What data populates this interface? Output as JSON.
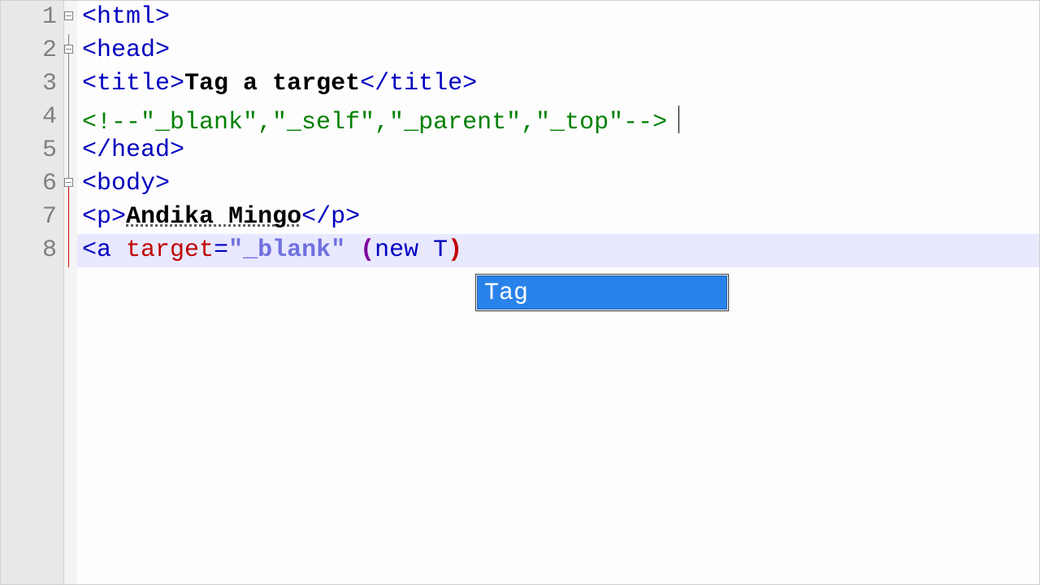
{
  "gutter": {
    "lines": [
      "1",
      "2",
      "3",
      "4",
      "5",
      "6",
      "7",
      "8"
    ]
  },
  "code": {
    "l1": {
      "open": "<",
      "tag": "html",
      "close": ">"
    },
    "l2": {
      "open": "<",
      "tag": "head",
      "close": ">"
    },
    "l3": {
      "open1": "<",
      "tag1": "title",
      "close1": ">",
      "text": "Tag a target",
      "open2": "</",
      "tag2": "title",
      "close2": ">"
    },
    "l4": {
      "comment": "<!--\"_blank\",\"_self\",\"_parent\",\"_top\"-->"
    },
    "l5": {
      "open": "</",
      "tag": "head",
      "close": ">"
    },
    "l6": {
      "open": "<",
      "tag": "body",
      "close": ">"
    },
    "l7": {
      "open1": "<",
      "tag1": "p",
      "close1": ">",
      "text": "Andika Mingo",
      "open2": "</",
      "tag2": "p",
      "close2": ">"
    },
    "l8": {
      "open": "<",
      "tag": "a",
      "sp": " ",
      "attr": "target",
      "eq": "=",
      "val": "\"_blank\"",
      "sp2": " ",
      "p1": "(",
      "inner": "new T",
      "p2": ")"
    }
  },
  "autocomplete": {
    "items": [
      "Tag"
    ]
  }
}
